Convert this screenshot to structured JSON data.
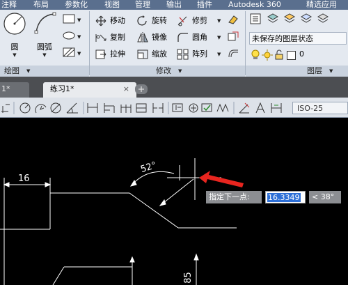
{
  "menubar": {
    "items": [
      "注释",
      "布局",
      "参数化",
      "视图",
      "管理",
      "输出",
      "插件",
      "Autodesk 360",
      "精选应用"
    ]
  },
  "ribbon": {
    "draw_panel": {
      "circle_label": "圆",
      "arc_label": "圆弧",
      "title": "绘图"
    },
    "modify_panel": {
      "title": "修改",
      "move": "移动",
      "rotate": "旋转",
      "trim": "修剪",
      "copy": "复制",
      "mirror": "镜像",
      "fillet": "圆角",
      "stretch": "拉伸",
      "scale": "缩放",
      "array": "阵列"
    },
    "layers_panel": {
      "title": "图层",
      "layer_state": "未保存的图层状态",
      "current_layer": "0"
    }
  },
  "tabs": {
    "partial_tab": "1*",
    "active_tab": "练习1*",
    "close_symbol": "×"
  },
  "dimension_toolbar": {
    "dimstyle": "ISO-25"
  },
  "drawing": {
    "dim_16": "16",
    "dim_angle": "52°",
    "dim_85": "85",
    "prompt": "指定下一点:",
    "length_value": "16.3349",
    "angle_value": "< 38°"
  },
  "colors": {
    "menubar_bg": "#5a6f8e",
    "ribbon_bg": "#e4e9f0",
    "tab_bar_bg": "#4c4e52",
    "canvas_bg": "#000000",
    "input_highlight": "#2d6fd6",
    "arrow_red": "#e8251f"
  },
  "icons": {
    "arrow": "red-pointer-arrow"
  }
}
